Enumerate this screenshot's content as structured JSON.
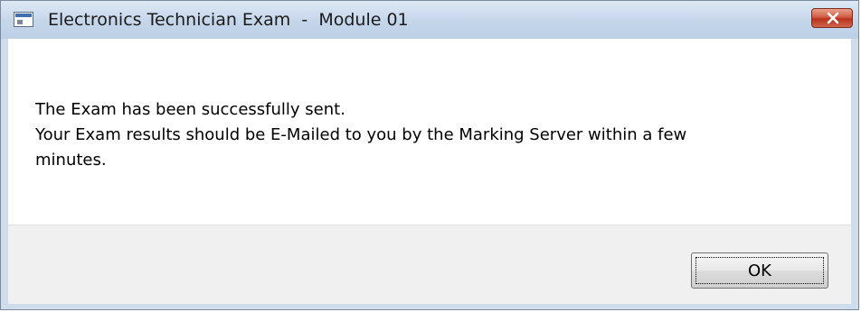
{
  "window": {
    "title": "Electronics Technician Exam  -  Module 01",
    "icon": "application-window-icon",
    "close_icon": "close-icon"
  },
  "message": {
    "line1": "The Exam has been successfully sent.",
    "line2": "Your Exam results should be E-Mailed to you by the Marking Server within a few",
    "line3": "minutes."
  },
  "buttons": {
    "ok_label": "OK"
  }
}
